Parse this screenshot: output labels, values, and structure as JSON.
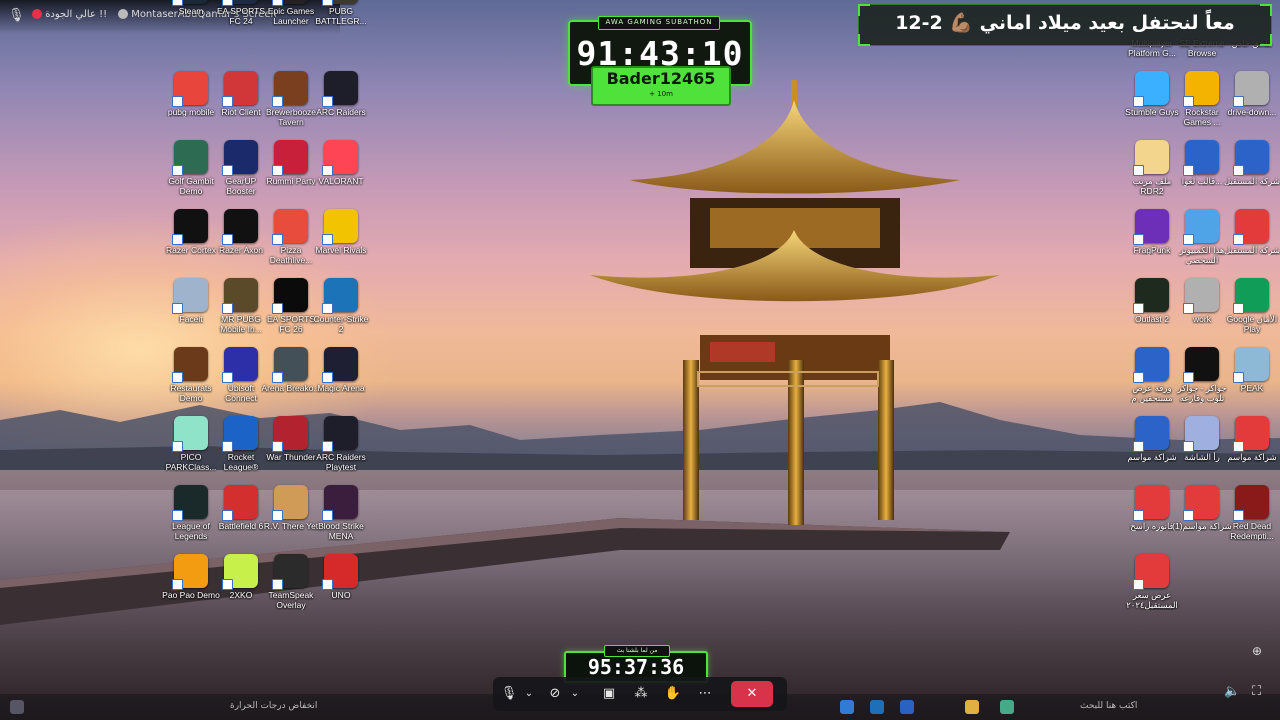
{
  "top_bar": {
    "status_text": "عالي الجودة !!",
    "stream_title": "MontaserAbuQamar's Screen",
    "colors": {
      "dot": "#e8304a"
    }
  },
  "subathon": {
    "title": "AWA GAMING SUBATHON",
    "timer": "91:43:10",
    "donor": "Bader12465",
    "added": "+ 10m",
    "accent": "#4fe23a"
  },
  "banner": {
    "text": "معاً لنحتفل بعيد ميلاد اماني 💪🏽 2-12"
  },
  "bottom_timer": {
    "caption": "من لما بلشنا بث",
    "timer": "95:37:36"
  },
  "desktop_left": [
    {
      "label": "Steam",
      "icon": "steam-icon",
      "color": "#1b2838"
    },
    {
      "label": "EA SPORTS FC 24",
      "icon": "ea-fc24-icon",
      "color": "#1c2a44"
    },
    {
      "label": "Epic Games Launcher",
      "icon": "epic-games-icon",
      "color": "#222"
    },
    {
      "label": "PUBG BATTLEGR...",
      "icon": "pubg-icon",
      "color": "#3b3a2c"
    },
    {
      "label": "pubg mobile",
      "icon": "pubg-mobile-icon",
      "color": "#e8453c"
    },
    {
      "label": "Riot Client",
      "icon": "riot-client-icon",
      "color": "#d13639"
    },
    {
      "label": "Brewerbooze Tavern",
      "icon": "beer-mug-icon",
      "color": "#7a3f1e"
    },
    {
      "label": "ARC Raiders",
      "icon": "arc-raiders-icon",
      "color": "#1e1e2a"
    },
    {
      "label": "Golf Gambit Demo",
      "icon": "golf-gambit-icon",
      "color": "#2d6b52"
    },
    {
      "label": "GearUP Booster",
      "icon": "gearup-icon",
      "color": "#1a2a6a"
    },
    {
      "label": "Rummi Party",
      "icon": "dice-icon",
      "color": "#c8203a"
    },
    {
      "label": "VALORANT",
      "icon": "valorant-icon",
      "color": "#fd4556"
    },
    {
      "label": "Razer Cortex",
      "icon": "razer-cortex-icon",
      "color": "#111"
    },
    {
      "label": "Razer Axon",
      "icon": "razer-axon-icon",
      "color": "#111"
    },
    {
      "label": "Pizza Deathlive...",
      "icon": "pizza-chef-icon",
      "color": "#e74c3c"
    },
    {
      "label": "Marvel Rivals",
      "icon": "marvel-rivals-icon",
      "color": "#f2c300"
    },
    {
      "label": "Faceit",
      "icon": "shield-icon",
      "color": "#9fb4cc"
    },
    {
      "label": "MR PUBG Mobile In...",
      "icon": "pubg-mobile-mr-icon",
      "color": "#5a4a2a"
    },
    {
      "label": "EA SPORTS FC 26",
      "icon": "ea-fc26-icon",
      "color": "#0b0b0b"
    },
    {
      "label": "Counter-Strike 2",
      "icon": "counter-strike-icon",
      "color": "#1d73b8"
    },
    {
      "label": "Restaurats Demo",
      "icon": "rat-chef-icon",
      "color": "#6a3a1a"
    },
    {
      "label": "Ubisoft Connect",
      "icon": "ubisoft-icon",
      "color": "#2c2fa8"
    },
    {
      "label": "Arena Breako...",
      "icon": "arena-breakout-icon",
      "color": "#445058"
    },
    {
      "label": "Magic Arena",
      "icon": "magic-arena-icon",
      "color": "#1f1f33"
    },
    {
      "label": "PICO PARKClass...",
      "icon": "pico-park-icon",
      "color": "#8ee3c9"
    },
    {
      "label": "Rocket League®",
      "icon": "rocket-league-icon",
      "color": "#1b63c6"
    },
    {
      "label": "War Thunder",
      "icon": "war-thunder-icon",
      "color": "#b3232f"
    },
    {
      "label": "ARC Raiders Playtest",
      "icon": "arc-raiders-icon",
      "color": "#1e1e2a"
    },
    {
      "label": "League of Legends",
      "icon": "league-icon",
      "color": "#1a2a2a"
    },
    {
      "label": "Battlefield 6",
      "icon": "battlefield-icon",
      "color": "#d32f2f"
    },
    {
      "label": "R.V. There Yet",
      "icon": "rv-there-yet-icon",
      "color": "#d09b57"
    },
    {
      "label": "Blood Strike MENA",
      "icon": "blood-strike-icon",
      "color": "#3b1e3e"
    },
    {
      "label": "Pao Pao Demo",
      "icon": "pao-pao-icon",
      "color": "#f39c12"
    },
    {
      "label": "2XKO",
      "icon": "2xko-icon",
      "color": "#c8f04a"
    },
    {
      "label": "TeamSpeak Overlay",
      "icon": "teamspeak-icon",
      "color": "#2b2b2b"
    },
    {
      "label": "UNO",
      "icon": "uno-icon",
      "color": "#d62a2a"
    }
  ],
  "desktop_right": [
    {
      "label": "Multiplayer Platform G...",
      "icon": "game-icon",
      "color": "",
      "cut": true
    },
    {
      "label": "SE Extreme Browse",
      "icon": "browser-icon",
      "color": "",
      "cut": true
    },
    {
      "label": "ملحق خاص",
      "icon": "file-icon",
      "color": "",
      "cut": true
    },
    {
      "label": "Stumble Guys",
      "icon": "stumble-guys-icon",
      "color": "#3ab0ff"
    },
    {
      "label": "Rockstar Games ...",
      "icon": "rockstar-icon",
      "color": "#f3b300"
    },
    {
      "label": "drive-down...",
      "icon": "zip-icon",
      "color": "#b0b0b0"
    },
    {
      "label": "ملف مرتب RDR2",
      "icon": "folder-icon",
      "color": "#f4d58d"
    },
    {
      "label": "قالب لعوا...",
      "icon": "word-doc-icon",
      "color": "#2b63c9"
    },
    {
      "label": "شركة المستقبل",
      "icon": "word-doc-icon",
      "color": "#2b63c9"
    },
    {
      "label": "FragPunk",
      "icon": "fragpunk-icon",
      "color": "#6d2fb8"
    },
    {
      "label": "هذا الكمبيوتر الشخصي",
      "icon": "computer-icon",
      "color": "#4ea4e6"
    },
    {
      "label": "شركة المستقبل",
      "icon": "pdf-icon",
      "color": "#e33b3b"
    },
    {
      "label": "Outlast 2",
      "icon": "outlast-icon",
      "color": "#1e2a1e"
    },
    {
      "label": "work",
      "icon": "zip-icon",
      "color": "#b0b0b0"
    },
    {
      "label": "Google الأمان Play",
      "icon": "google-play-icon",
      "color": "#0f9d58"
    },
    {
      "label": "ورقة عرض مستحقين م",
      "icon": "word-doc-icon",
      "color": "#2b63c9"
    },
    {
      "label": "جواكر - جواكر تلوب وقارعه",
      "icon": "jawaker-icon",
      "color": "#111"
    },
    {
      "label": "PEAK",
      "icon": "peak-icon",
      "color": "#8db9d6"
    },
    {
      "label": "شراكة مواسم",
      "icon": "word-doc-icon",
      "color": "#2b63c9"
    },
    {
      "label": "رأ الشاشة",
      "icon": "screen-app-icon",
      "color": "#9fb0e0"
    },
    {
      "label": "شراكة مواسم",
      "icon": "pdf-icon",
      "color": "#e33b3b"
    },
    {
      "label": "فاتورة راسخ",
      "icon": "pdf-icon",
      "color": "#e33b3b"
    },
    {
      "label": "شراكة مواسم(1)",
      "icon": "pdf-icon",
      "color": "#e33b3b"
    },
    {
      "label": "Red Dead Redempti...",
      "icon": "red-dead-icon",
      "color": "#8a1a1a"
    },
    {
      "label": "عرض سعر المستقبل٢٠٢٤",
      "icon": "pdf-icon",
      "color": "#e33b3b"
    }
  ],
  "taskbar": {
    "weather": "انخفاض درجات الحرارة",
    "search_placeholder": "اكتب هنا للبحث"
  }
}
